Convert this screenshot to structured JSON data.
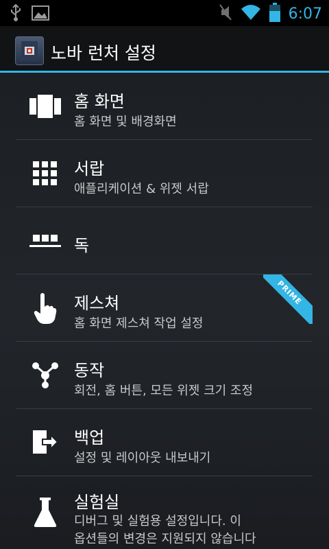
{
  "status_bar": {
    "time": "6:07",
    "icons": [
      "usb-icon",
      "image-icon",
      "mute-icon",
      "wifi-icon",
      "battery-icon"
    ],
    "accent_color": "#33b5e5"
  },
  "header": {
    "title": "노바 런처 설정"
  },
  "items": [
    {
      "title": "홈 화면",
      "subtitle": "홈 화면 및 배경화면",
      "icon": "homescreen-icon"
    },
    {
      "title": "서랍",
      "subtitle": "애플리케이션 & 위젯 서랍",
      "icon": "drawer-grid-icon"
    },
    {
      "title": "독",
      "subtitle": "",
      "icon": "dock-icon"
    },
    {
      "title": "제스쳐",
      "subtitle": "홈 화면 제스쳐 작업 설정",
      "icon": "gesture-hand-icon",
      "badge": "PRIME"
    },
    {
      "title": "동작",
      "subtitle": "회전, 홈 버튼, 모든 위젯 크기 조정",
      "icon": "behavior-icon"
    },
    {
      "title": "백업",
      "subtitle": "설정 및 레이아웃 내보내기",
      "icon": "backup-export-icon"
    },
    {
      "title": "실험실",
      "subtitle_line1": "디버그 및 실험용 설정입니다. 이",
      "subtitle_line2": "옵션들의 변경은 지원되지 않습니다",
      "icon": "labs-flask-icon"
    }
  ]
}
